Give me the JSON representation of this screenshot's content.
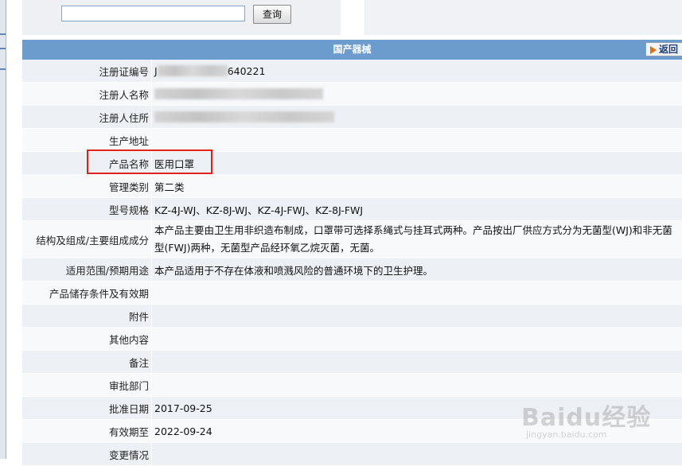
{
  "search": {
    "value": "",
    "button_label": "查询"
  },
  "table": {
    "title": "国产器械",
    "back_label": "返回",
    "rows": [
      {
        "label": "注册证编号",
        "value": "640221",
        "prefix": "J",
        "redacted": true
      },
      {
        "label": "注册人名称",
        "value": "",
        "redacted": true
      },
      {
        "label": "注册人住所",
        "value": "",
        "redacted": true
      },
      {
        "label": "生产地址",
        "value": ""
      },
      {
        "label": "产品名称",
        "value": "医用口罩"
      },
      {
        "label": "管理类别",
        "value": "第二类"
      },
      {
        "label": "型号规格",
        "value": "KZ-4J-WJ、KZ-8J-WJ、KZ-4J-FWJ、KZ-8J-FWJ"
      },
      {
        "label": "结构及组成/主要组成成分",
        "value": "本产品主要由卫生用非织造布制成，口罩带可选择系绳式与挂耳式两种。产品按出厂供应方式分为无菌型(WJ)和非无菌型(FWJ)两种，无菌型产品经环氧乙烷灭菌，无菌。"
      },
      {
        "label": "适用范围/预期用途",
        "value": "本产品适用于不存在体液和喷溅风险的普通环境下的卫生护理。"
      },
      {
        "label": "产品储存条件及有效期",
        "value": ""
      },
      {
        "label": "附件",
        "value": ""
      },
      {
        "label": "其他内容",
        "value": ""
      },
      {
        "label": "备注",
        "value": ""
      },
      {
        "label": "审批部门",
        "value": ""
      },
      {
        "label": "批准日期",
        "value": "2017-09-25"
      },
      {
        "label": "有效期至",
        "value": "2022-09-24"
      },
      {
        "label": "变更情况",
        "value": ""
      }
    ]
  },
  "watermark": {
    "text": "Baidu经验",
    "sub": "jingyan.baidu.com"
  },
  "colors": {
    "header_bg": "#6c9cce",
    "highlight": "#e0221c",
    "row_odd": "#edf0f4",
    "row_even": "#f8f9fb"
  }
}
